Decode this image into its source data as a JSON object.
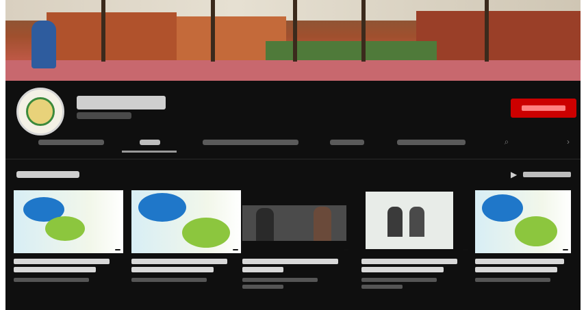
{
  "channel": {
    "name": "",
    "subscribers": "",
    "subscribe_label": ""
  },
  "tabs": [
    {
      "label": "",
      "active": false
    },
    {
      "label": "",
      "active": true
    },
    {
      "label": "",
      "active": false
    },
    {
      "label": "",
      "active": false
    },
    {
      "label": "",
      "active": false
    }
  ],
  "section": {
    "title": "",
    "play_all_label": ""
  },
  "videos": [
    {
      "title": "",
      "meta": "",
      "duration": ""
    },
    {
      "title": "",
      "meta": "",
      "duration": ""
    },
    {
      "title": "",
      "meta": "",
      "duration": ""
    },
    {
      "title": "",
      "meta": "",
      "duration": ""
    },
    {
      "title": "",
      "meta": "",
      "duration": ""
    }
  ],
  "colors": {
    "background": "#0f0f0f",
    "subscribe": "#cc0000"
  },
  "icons": [
    "search-icon",
    "chevron-right-icon",
    "play-all-icon"
  ]
}
